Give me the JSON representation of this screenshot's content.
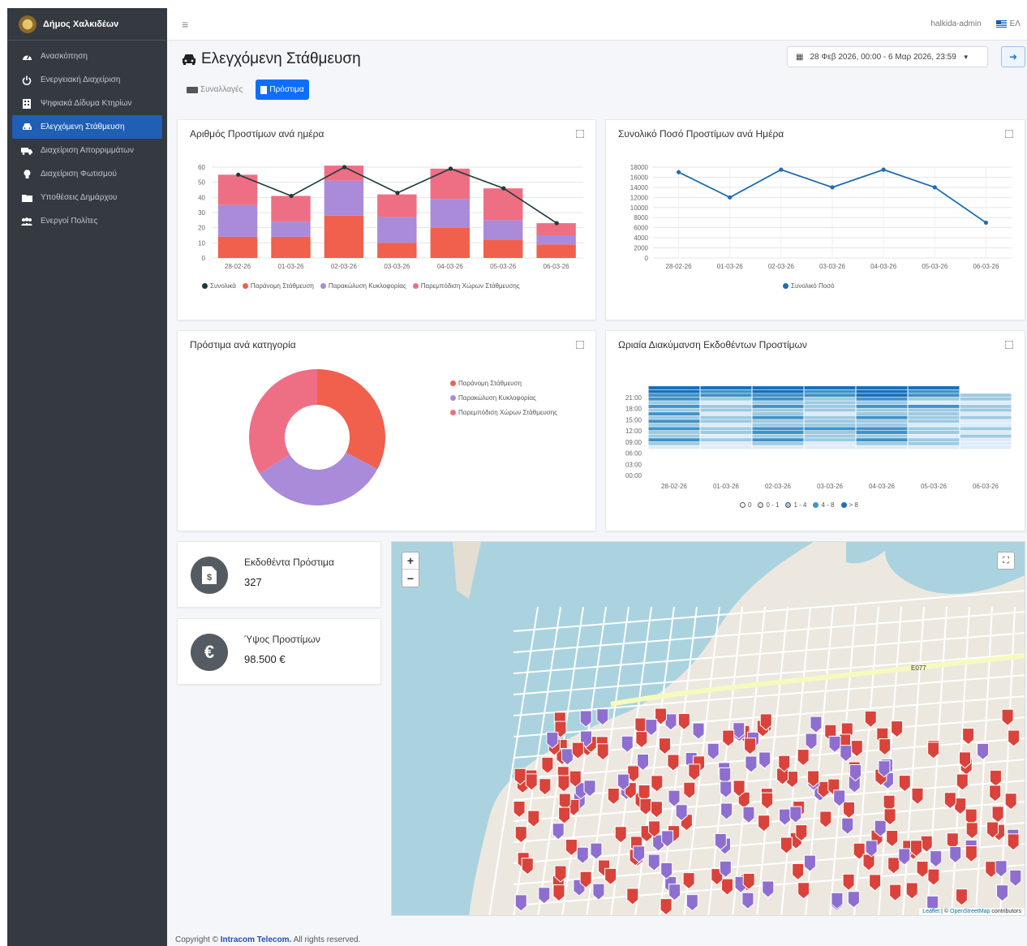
{
  "sidebar": {
    "brand": "Δήμος Χαλκιδέων",
    "items": [
      {
        "label": "Ανασκόπηση",
        "icon": "tachometer-icon",
        "active": false
      },
      {
        "label": "Ενεργειακή Διαχείριση",
        "icon": "power-icon",
        "active": false
      },
      {
        "label": "Ψηφιακά Δίδυμα Κτηρίων",
        "icon": "building-icon",
        "active": false
      },
      {
        "label": "Ελεγχόμενη Στάθμευση",
        "icon": "car-icon",
        "active": true
      },
      {
        "label": "Διαχείριση Απορριμμάτων",
        "icon": "truck-icon",
        "active": false
      },
      {
        "label": "Διαχείριση Φωτισμού",
        "icon": "lightbulb-icon",
        "active": false
      },
      {
        "label": "Υποθέσεις Δημάρχου",
        "icon": "folder-icon",
        "active": false
      },
      {
        "label": "Ενεργοί Πολίτες",
        "icon": "users-icon",
        "active": false
      }
    ]
  },
  "topbar": {
    "user": "halkida-admin",
    "lang": "ΕΛ"
  },
  "page": {
    "title": "Ελεγχόμενη Στάθμευση",
    "daterange": "28 Φεβ 2026, 00:00 - 6 Μαρ 2026, 23:59"
  },
  "tabs": [
    {
      "label": "Συναλλαγές",
      "active": false
    },
    {
      "label": "Πρόστιμα",
      "active": true
    }
  ],
  "cards": {
    "fines_per_day": "Αριθμός Προστίμων ανά ημέρα",
    "amount_per_day": "Συνολικό Ποσό Προστίμων ανά Ημέρα",
    "by_category": "Πρόστιμα ανά κατηγορία",
    "hourly": "Ωριαία Διακύμανση Εκδοθέντων Προστίμων"
  },
  "stats": [
    {
      "label": "Εκδοθέντα Πρόστιμα",
      "value": "327",
      "icon": "invoice-dollar-icon"
    },
    {
      "label": "Ύψος Προστίμων",
      "value": "98.500 €",
      "icon": "euro-icon"
    }
  ],
  "map": {
    "zoom_in": "+",
    "zoom_out": "−",
    "attribution_leaflet": "Leaflet",
    "attribution_osm": "OpenStreetMap",
    "attribution_suffix": "contributors",
    "label_e077": "E077"
  },
  "footer": {
    "prefix": "Copyright ©",
    "company": "Intracom Telecom.",
    "suffix": "All rights reserved."
  },
  "colors": {
    "parking": "#f0604d",
    "blocking": "#a98bd9",
    "obstruction": "#ee6f84",
    "total": "#1b3b3b",
    "amount": "#1f6db5",
    "sidebar": "#343a40",
    "active": "#1f5fb5"
  },
  "chart_data": [
    {
      "type": "bar",
      "title": "Αριθμός Προστίμων ανά ημέρα",
      "categories": [
        "28-02-26",
        "01-03-26",
        "02-03-26",
        "03-03-26",
        "04-03-26",
        "05-03-26",
        "06-03-26"
      ],
      "ylim": [
        0,
        60
      ],
      "yticks": [
        0,
        10,
        20,
        30,
        40,
        50,
        60
      ],
      "stacked": true,
      "series": [
        {
          "name": "Παράνομη Στάθμευση",
          "values": [
            14,
            14,
            28,
            10,
            20,
            12,
            9
          ],
          "color": "#f0604d"
        },
        {
          "name": "Παρακώλυση Κυκλοφορίας",
          "values": [
            21,
            10,
            23,
            17,
            19,
            13,
            6
          ],
          "color": "#a98bd9"
        },
        {
          "name": "Παρεμπόδιση Χώρων Στάθμευσης",
          "values": [
            20,
            17,
            10,
            15,
            20,
            21,
            8
          ],
          "color": "#ee6f84"
        }
      ],
      "line": {
        "name": "Συνολικά",
        "values": [
          55,
          41,
          60,
          43,
          59,
          46,
          23
        ]
      },
      "legend": [
        "Συνολικά",
        "Παράνομη Στάθμευση",
        "Παρακώλυση Κυκλοφορίας",
        "Παρεμπόδιση Χώρων Στάθμευσης"
      ]
    },
    {
      "type": "line",
      "title": "Συνολικό Ποσό Προστίμων ανά Ημέρα",
      "categories": [
        "28-02-26",
        "01-03-26",
        "02-03-26",
        "03-03-26",
        "04-03-26",
        "05-03-26",
        "06-03-26"
      ],
      "ylim": [
        0,
        18000
      ],
      "yticks": [
        0,
        2000,
        4000,
        6000,
        8000,
        10000,
        12000,
        14000,
        16000,
        18000
      ],
      "series": [
        {
          "name": "Συνολικό Ποσό",
          "values": [
            17000,
            12000,
            17500,
            14000,
            17500,
            14000,
            7000
          ]
        }
      ]
    },
    {
      "type": "pie",
      "title": "Πρόστιμα ανά κατηγορία",
      "labels": [
        "Παράνομη Στάθμευση",
        "Παρακώλυση Κυκλοφορίας",
        "Παρεμπόδιση Χώρων Στάθμευσης"
      ],
      "values": [
        107,
        109,
        111
      ],
      "colors": [
        "#f0604d",
        "#a98bd9",
        "#ee6f84"
      ]
    },
    {
      "type": "heatmap",
      "title": "Ωριαία Διακύμανση Εκδοθέντων Προστίμων",
      "x": [
        "28-02-26",
        "01-03-26",
        "02-03-26",
        "03-03-26",
        "04-03-26",
        "05-03-26",
        "06-03-26"
      ],
      "yticks": [
        "00:00",
        "03:00",
        "06:00",
        "09:00",
        "12:00",
        "15:00",
        "18:00",
        "21:00"
      ],
      "legend": [
        "0",
        "0 - 1",
        "1 - 4",
        "4 - 8",
        "> 8"
      ],
      "levels": [
        [
          0,
          0,
          0,
          0,
          0,
          0,
          0
        ],
        [
          0,
          0,
          0,
          0,
          0,
          0,
          0
        ],
        [
          0,
          0,
          0,
          0,
          0,
          0,
          0
        ],
        [
          0,
          0,
          0,
          0,
          0,
          0,
          0
        ],
        [
          0,
          0,
          0,
          0,
          0,
          0,
          0
        ],
        [
          0,
          0,
          0,
          0,
          0,
          0,
          0
        ],
        [
          0,
          0,
          0,
          0,
          0,
          0,
          0
        ],
        [
          1,
          1,
          1,
          1,
          1,
          1,
          1
        ],
        [
          2,
          1,
          2,
          1,
          2,
          2,
          1
        ],
        [
          3,
          2,
          3,
          2,
          3,
          2,
          1
        ],
        [
          2,
          1,
          2,
          2,
          2,
          1,
          2
        ],
        [
          2,
          2,
          3,
          2,
          3,
          2,
          1
        ],
        [
          3,
          2,
          3,
          3,
          3,
          2,
          2
        ],
        [
          2,
          1,
          2,
          2,
          2,
          1,
          1
        ],
        [
          3,
          2,
          2,
          2,
          2,
          2,
          1
        ],
        [
          2,
          2,
          3,
          2,
          3,
          2,
          2
        ],
        [
          3,
          1,
          2,
          1,
          2,
          2,
          1
        ],
        [
          2,
          2,
          2,
          2,
          2,
          2,
          2
        ],
        [
          3,
          2,
          3,
          2,
          3,
          3,
          2
        ],
        [
          2,
          1,
          2,
          2,
          2,
          1,
          1
        ],
        [
          3,
          2,
          3,
          2,
          3,
          2,
          2
        ],
        [
          3,
          3,
          3,
          3,
          4,
          3,
          2
        ],
        [
          4,
          3,
          4,
          3,
          4,
          3,
          0
        ],
        [
          4,
          4,
          4,
          4,
          4,
          4,
          0
        ]
      ]
    }
  ]
}
